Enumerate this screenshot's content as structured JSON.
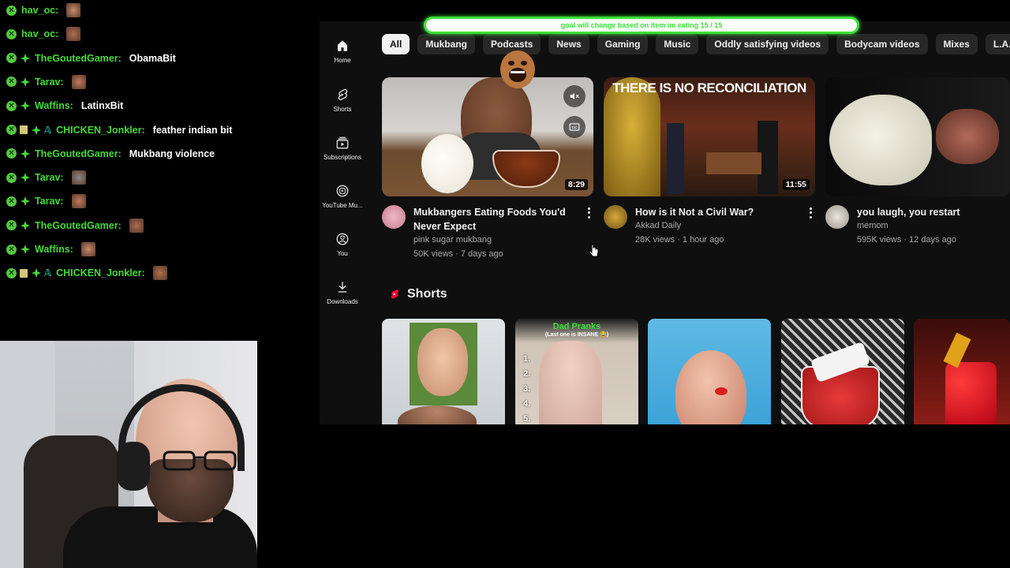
{
  "goal": {
    "text": "goal will change based on item im eating 15 / 15"
  },
  "chat": [
    {
      "user": "hav_oc:",
      "msg": "",
      "badges": [
        "mod"
      ],
      "emote": "face-emote"
    },
    {
      "user": "hav_oc:",
      "msg": "",
      "badges": [
        "mod"
      ],
      "emote": "face-emote"
    },
    {
      "user": "TheGoutedGamer:",
      "msg": "ObamaBit",
      "badges": [
        "mod",
        "sub"
      ]
    },
    {
      "user": "Tarav:",
      "msg": "",
      "badges": [
        "mod",
        "sub"
      ],
      "emote": "face-emote"
    },
    {
      "user": "Waffins:",
      "msg": "LatinxBit",
      "badges": [
        "mod",
        "sub"
      ]
    },
    {
      "user": "CHICKEN_Jonkler:",
      "msg": "feather indian bit",
      "badges": [
        "mod",
        "ticket",
        "sub",
        "arch"
      ]
    },
    {
      "user": "TheGoutedGamer:",
      "msg": "Mukbang violence",
      "badges": [
        "mod",
        "sub"
      ]
    },
    {
      "user": "Tarav:",
      "msg": "",
      "badges": [
        "mod",
        "sub"
      ],
      "emote": "face-emote"
    },
    {
      "user": "Tarav:",
      "msg": "",
      "badges": [
        "mod",
        "sub"
      ],
      "emote": "face-emote"
    },
    {
      "user": "TheGoutedGamer:",
      "msg": "",
      "badges": [
        "mod",
        "sub"
      ],
      "emote": "face-emote"
    },
    {
      "user": "Waffins:",
      "msg": "",
      "badges": [
        "mod",
        "sub"
      ],
      "emote": "face-emote"
    },
    {
      "user": "CHICKEN_Jonkler:",
      "msg": "",
      "badges": [
        "mod",
        "ticket",
        "sub",
        "arch"
      ],
      "emote": "face-emote"
    }
  ],
  "sidebar": {
    "items": [
      {
        "label": "Home",
        "icon": "home-icon"
      },
      {
        "label": "Shorts",
        "icon": "shorts-icon"
      },
      {
        "label": "Subscriptions",
        "icon": "subscriptions-icon"
      },
      {
        "label": "YouTube Mu...",
        "icon": "youtube-music-icon"
      },
      {
        "label": "You",
        "icon": "you-icon"
      },
      {
        "label": "Downloads",
        "icon": "download-icon"
      }
    ]
  },
  "chips": [
    "All",
    "Mukbang",
    "Podcasts",
    "News",
    "Gaming",
    "Music",
    "Oddly satisfying videos",
    "Bodycam videos",
    "Mixes",
    "L.A. Beast"
  ],
  "videos": [
    {
      "title": "Mukbangers Eating Foods You'd Never Expect",
      "channel": "pink sugar mukbang",
      "stats": "50K views · 7 days ago",
      "duration": "8:29"
    },
    {
      "title": "How is it Not a Civil War?",
      "channel": "Akkad Daily",
      "stats": "28K views · 1 hour ago",
      "duration": "11:55",
      "overlay_text": "THERE IS NO RECONCILIATION"
    },
    {
      "title": "you laugh, you restart",
      "channel": "memom",
      "stats": "595K views · 12 days ago",
      "duration": ""
    }
  ],
  "shorts": {
    "heading": "Shorts",
    "items": [
      {
        "caption": ""
      },
      {
        "caption": "Dad Pranks",
        "sub": "(Last one is INSANE 😂)",
        "list": [
          "1.",
          "2.",
          "3.",
          "4.",
          "5."
        ]
      },
      {
        "caption": ""
      },
      {
        "caption": ""
      },
      {
        "caption": ""
      }
    ]
  },
  "colors": {
    "chat_user": "#45d83a",
    "goal_accent": "#3be03b",
    "yt_bg": "#0f0f0f",
    "chip_bg": "#272727"
  }
}
